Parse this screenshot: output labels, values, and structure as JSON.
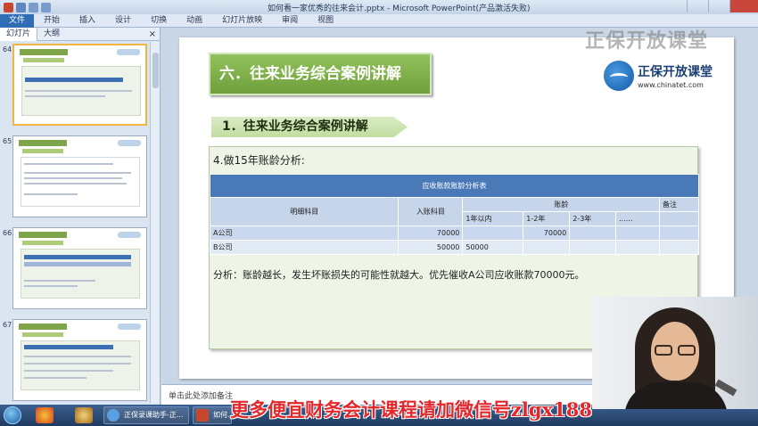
{
  "app": {
    "title": "如何看一家优秀的往来会计.pptx - Microsoft PowerPoint(产品激活失败)"
  },
  "ribbon": {
    "tabs": [
      "文件",
      "开始",
      "插入",
      "设计",
      "切换",
      "动画",
      "幻灯片放映",
      "审阅",
      "视图"
    ]
  },
  "left_panel": {
    "tabs": [
      "幻灯片",
      "大纲"
    ],
    "close": "×",
    "slide_numbers": [
      "64",
      "65",
      "66",
      "67"
    ]
  },
  "slide": {
    "title": "六．往来业务综合案例讲解",
    "subtitle": "1．往来业务综合案例讲解",
    "logo_name": "正保开放课堂",
    "logo_url": "www.chinatet.com",
    "box_heading": "4.做15年账龄分析:",
    "table": {
      "caption": "应收账款账龄分析表",
      "header": {
        "col1": "明细科目",
        "col2": "入账科目",
        "group": "账龄",
        "remark": "备注",
        "sub": [
          "1年以内",
          "1-2年",
          "2-3年",
          "......"
        ]
      },
      "rows": [
        {
          "name": "A公司",
          "amount": "70000",
          "y1": "",
          "y2": "70000",
          "y3": "",
          "y4": "",
          "remark": ""
        },
        {
          "name": "B公司",
          "amount": "50000",
          "y1": "50000",
          "y2": "",
          "y3": "",
          "y4": "",
          "remark": ""
        }
      ]
    },
    "analysis": "分析：账龄越长，发生坏账损失的可能性就越大。优先催收A公司应收账款70000元。"
  },
  "notes": {
    "text": "单击此处添加备注"
  },
  "taskbar": {
    "items": [
      "正保录课助手-正...",
      "如何..."
    ]
  },
  "overlay": {
    "watermark": "正保开放课堂",
    "banner": "更多便宜财务会计课程请加微信号zlgx188"
  },
  "colors": {
    "slide_title_green": "#7fae48",
    "table_blue": "#4a79b8",
    "banner_red": "#e3282c"
  }
}
